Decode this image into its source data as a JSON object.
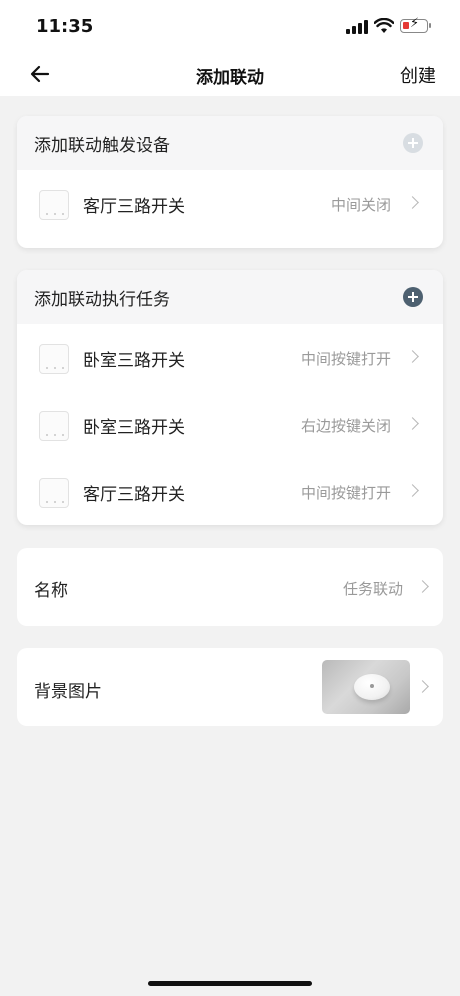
{
  "status_bar": {
    "time": "11:35"
  },
  "nav": {
    "title": "添加联动",
    "create_label": "创建"
  },
  "trigger_section": {
    "title": "添加联动触发设备",
    "items": [
      {
        "device": "客厅三路开关",
        "action": "中间关闭"
      }
    ]
  },
  "task_section": {
    "title": "添加联动执行任务",
    "items": [
      {
        "device": "卧室三路开关",
        "action": "中间按键打开"
      },
      {
        "device": "卧室三路开关",
        "action": "右边按键关闭"
      },
      {
        "device": "客厅三路开关",
        "action": "中间按键打开"
      }
    ]
  },
  "name_row": {
    "label": "名称",
    "value": "任务联动"
  },
  "background_row": {
    "label": "背景图片"
  },
  "colors": {
    "add_active": "#4d6070",
    "add_disabled": "#d8dde2",
    "page_bg": "#f2f2f2"
  },
  "icons": [
    "back-arrow-icon",
    "add-icon",
    "chevron-right-icon",
    "switch-device-icon",
    "signal-icon",
    "wifi-icon",
    "battery-icon"
  ]
}
